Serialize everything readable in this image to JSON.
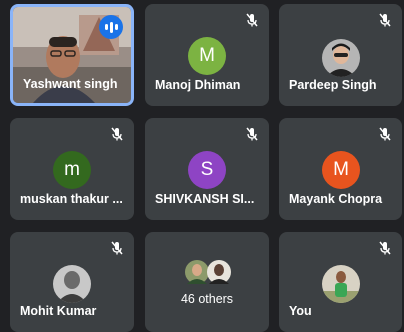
{
  "participants": [
    {
      "name": "Yashwant singh",
      "speaking": true,
      "muted": false,
      "avatar": "video"
    },
    {
      "name": "Manoj Dhiman",
      "muted": true,
      "avatar": "letter",
      "letter": "M",
      "color": "#7cb342"
    },
    {
      "name": "Pardeep Singh",
      "muted": true,
      "avatar": "photo"
    },
    {
      "name": "muskan thakur ...",
      "muted": true,
      "avatar": "letter",
      "letter": "m",
      "color": "#33691e"
    },
    {
      "name": "SHIVKANSH SI...",
      "muted": true,
      "avatar": "letter",
      "letter": "S",
      "color": "#8e44c4"
    },
    {
      "name": "Mayank Chopra",
      "muted": true,
      "avatar": "letter",
      "letter": "M",
      "color": "#e8541e"
    },
    {
      "name": "Mohit Kumar",
      "muted": true,
      "avatar": "photo"
    },
    {
      "name": "You",
      "muted": true,
      "avatar": "photo"
    }
  ],
  "others": {
    "label": "46 others"
  },
  "colors": {
    "active_border": "#8ab4f8",
    "tile_bg": "#3c4043",
    "page_bg": "#202124"
  }
}
